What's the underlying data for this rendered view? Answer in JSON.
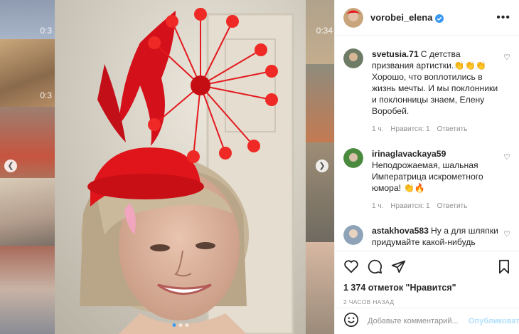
{
  "colors": {
    "accent": "#3897f0",
    "hat_red": "#e0141b",
    "muted": "#8e8e8e",
    "publish_disabled": "#b2dffc"
  },
  "background": {
    "left_tiles": [
      {
        "duration": "0:3"
      },
      {
        "duration": "0:3"
      },
      {
        "duration": ""
      },
      {
        "duration": ""
      },
      {
        "duration": ""
      }
    ],
    "right_tiles": [
      {
        "duration": "0:34"
      }
    ]
  },
  "post": {
    "username": "vorobei_elena",
    "verified": true,
    "more_icon": "more-horizontal-icon",
    "photo_alt": "photo",
    "comments": [
      {
        "user": "svetusia.71",
        "text": "С детства призвания артистки.👏👏👏Хорошо, что воплотились в жизнь мечты. И мы поклонники и поклонницы знаем, Елену Воробей.",
        "time": "1 ч.",
        "likes": "Нравится: 1",
        "reply": "Ответить",
        "avatar_color": "#6e7c66"
      },
      {
        "user": "irinaglavackaya59",
        "text": "Неподрожаемая, шальная Императрица искрометного юмора! 👏🔥",
        "time": "1 ч.",
        "likes": "Нравится: 1",
        "reply": "Ответить",
        "avatar_color": "#4a8a3e"
      },
      {
        "user": "astakhova583",
        "text": "Ну а для шляпки придумайте какой-нибудь номер типа- Ну возьмите меня! 😁",
        "time": "",
        "likes": "",
        "reply": "",
        "avatar_color": "#8fa3b8"
      }
    ],
    "likes_text": "1 374 отметок \"Нравится\"",
    "time_ago": "2 ЧАСОВ НАЗАД",
    "comment_placeholder": "Добавьте комментарий...",
    "publish_label": "Опубликовать"
  }
}
